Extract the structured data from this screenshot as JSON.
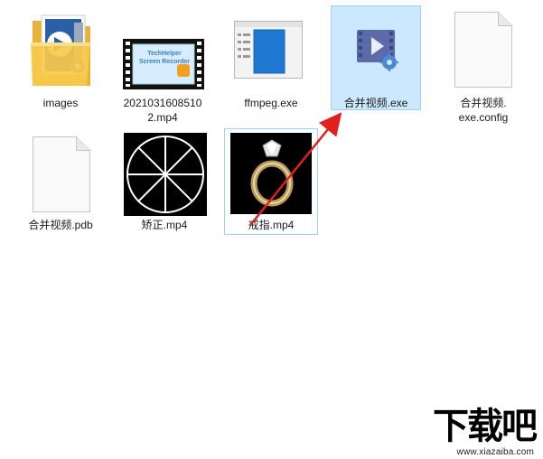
{
  "files": [
    {
      "name": "images",
      "icon": "folder-icon",
      "selected": false
    },
    {
      "name": "20210316085102.mp4",
      "icon": "video-thumbnail",
      "thumb_text": [
        "TechHelper",
        "Screen Recorder"
      ],
      "selected": false
    },
    {
      "name": "ffmpeg.exe",
      "icon": "exe-window-icon",
      "selected": false
    },
    {
      "name": "合并视频.exe",
      "icon": "video-app-icon",
      "selected": true
    },
    {
      "name": "合并视频.exe.config",
      "icon": "blank-file-icon",
      "selected": false
    },
    {
      "name": "合并视频.pdb",
      "icon": "blank-file-icon",
      "selected": false
    },
    {
      "name": "矫正.mp4",
      "icon": "circle-video-thumbnail",
      "selected": false
    },
    {
      "name": "戒指.mp4",
      "icon": "ring-video-thumbnail",
      "selected": false,
      "focused": true
    }
  ],
  "labels": {
    "images": "images",
    "mp4a_line1": "2021031608510",
    "mp4a_line2": "2.mp4",
    "ffmpeg": "ffmpeg.exe",
    "merge_exe": "合并视频.exe",
    "config_line1": "合并视频.",
    "config_line2": "exe.config",
    "pdb": "合并视频.pdb",
    "jiaozheng": "矫正.mp4",
    "jiezhi": "戒指.mp4",
    "thumb_line1": "TechHelper",
    "thumb_line2": "Screen Recorder"
  },
  "annotation": {
    "type": "red-arrow",
    "color": "#e02020",
    "points_to": "合并视频.exe"
  },
  "watermark": {
    "logo_text": "下载吧",
    "url": "www.xiazaiba.com"
  },
  "colors": {
    "selection_bg": "#cce8ff",
    "selection_border": "#99d1ff",
    "folder": "#f7c94a",
    "app_icon": "#5b6aa8"
  }
}
